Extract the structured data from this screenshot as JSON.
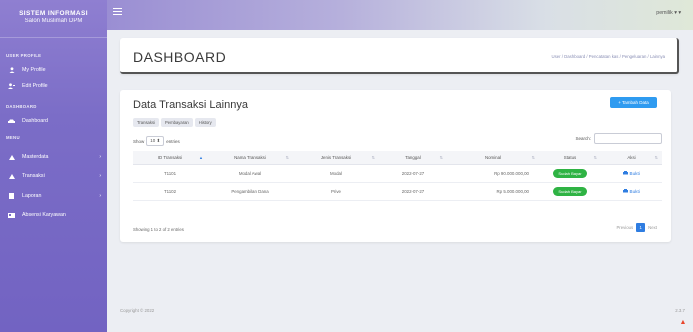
{
  "brand": {
    "line1": "SISTEM INFORMASI",
    "line2": "Salon Muslimah DPM"
  },
  "sidebar": {
    "sections": {
      "user": "USER PROFILE",
      "dashboard": "DASHBOARD",
      "menu": "MENU"
    },
    "items": [
      {
        "label": "My Profile",
        "icon": "user-icon"
      },
      {
        "label": "Edit Profile",
        "icon": "user-edit-icon"
      },
      {
        "label": "Dashboard",
        "icon": "car-icon"
      },
      {
        "label": "Masterdata",
        "icon": "triangle-icon",
        "chevron": "›"
      },
      {
        "label": "Transaksi",
        "icon": "triangle-icon",
        "chevron": "›"
      },
      {
        "label": "Laporan",
        "icon": "file-icon",
        "chevron": "›"
      },
      {
        "label": "Absensi Karyawan",
        "icon": "id-card-icon"
      }
    ]
  },
  "topbar": {
    "user": "pemilik  ▾  ▾"
  },
  "header": {
    "title": "DASHBOARD",
    "breadcrumb": "User  /  Dashboard  /  Pencatatan kas  /  Pengeluaran  /  Lainnya"
  },
  "card": {
    "title": "Data Transaksi Lainnya",
    "add_button": "+ Tambah Data",
    "tabs": [
      "Transaksi",
      "Pembayaran",
      "History"
    ],
    "show_label": "Show",
    "show_value": "10 ⬍",
    "entries_label": "entries",
    "search_label": "Search:"
  },
  "table": {
    "headers": [
      "ID Transaksi",
      "Nama Transaksi",
      "Jenis Transaksi",
      "Tanggal",
      "Nominal",
      "Status",
      "Aksi"
    ],
    "rows": [
      {
        "id": "T1101",
        "nama": "Modal Awal",
        "jenis": "Modal",
        "tanggal": "2022-07-27",
        "nominal": "Rp 90.000.000,00",
        "status": "Sudah Bayar",
        "aksi": "Bukti"
      },
      {
        "id": "T1102",
        "nama": "Pengambilan Dana",
        "jenis": "Prive",
        "tanggal": "2022-07-27",
        "nominal": "Rp 5.000.000,00",
        "status": "Sudah Bayar",
        "aksi": "Bukti"
      }
    ]
  },
  "pagination": {
    "info": "Showing 1 to 2 of 2 entries",
    "previous": "Previous",
    "current": "1",
    "next": "Next"
  },
  "footer": {
    "copyright": "Copyright © 2022",
    "version": "2.3.7"
  },
  "colors": {
    "sidebar": "#7b6dc7",
    "primary": "#2f9bf0",
    "success": "#2fb344",
    "link": "#2f7de1"
  }
}
